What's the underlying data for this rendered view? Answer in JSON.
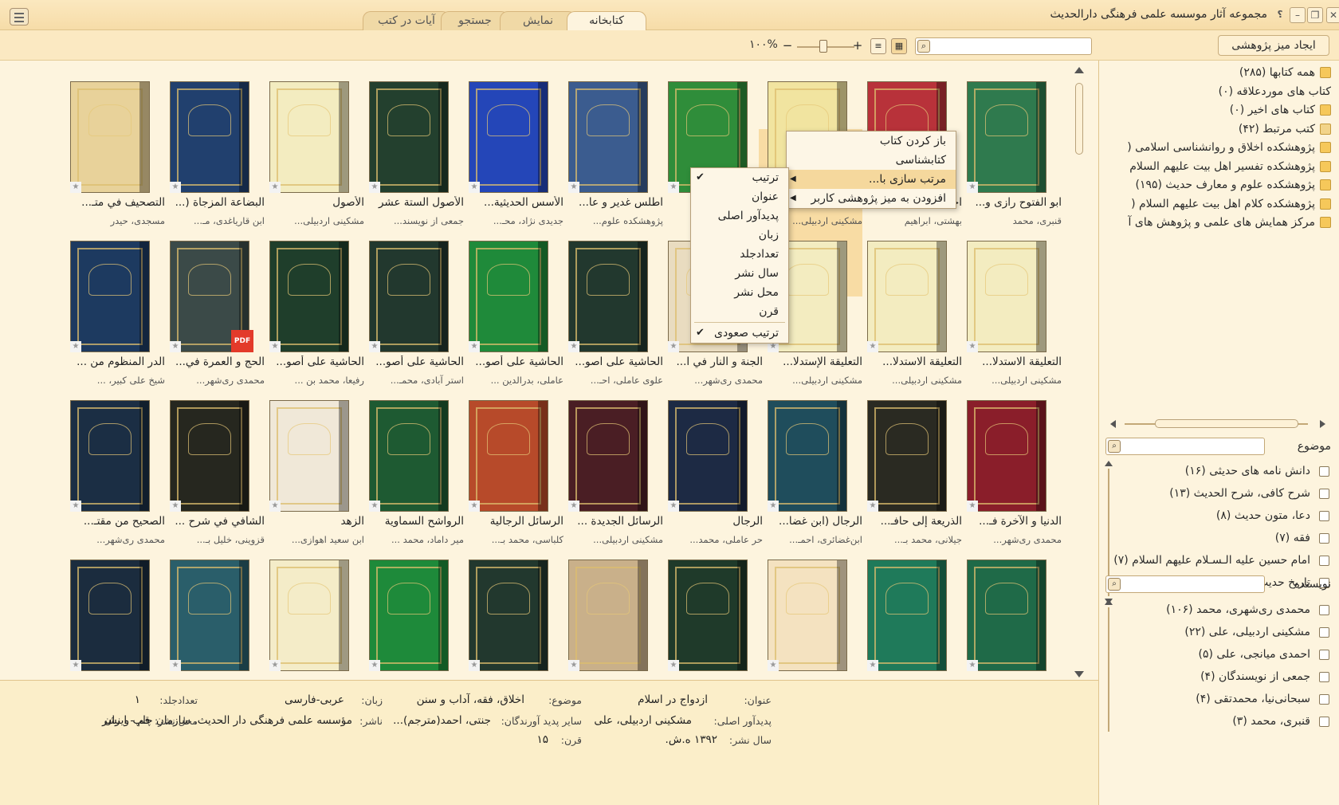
{
  "window": {
    "title": "مجموعه آثار موسسه علمی فرهنگی دارالحدیث",
    "help": "؟"
  },
  "tabs": [
    {
      "label": "کتابخانه",
      "active": true
    },
    {
      "label": "نمایش"
    },
    {
      "label": "جستجو"
    },
    {
      "label": "آیات در کتب"
    }
  ],
  "toolbar": {
    "create_desk": "ایجاد میز پژوهشی",
    "zoom_label": "۱۰۰%",
    "zoom_minus": "−",
    "zoom_plus": "+",
    "search_placeholder": ""
  },
  "books": [
    {
      "title": "ابو الفتوح رازی و...",
      "author": "قنبری، محمد",
      "color": "#2f7a4e"
    },
    {
      "title": "احمد بکیر...",
      "author": "بهشتی، ابراهیم",
      "color": "#b8323a"
    },
    {
      "title": "ازدواج در اسلام",
      "author": "مشکینی اردبیلی...",
      "color": "#f1e4a0"
    },
    {
      "title": "...ف الـ...",
      "author": "...ود",
      "color": "#2f8d3a"
    },
    {
      "title": "اطلس غدیر و عا...",
      "author": "پژوهشکده علوم...",
      "color": "#3b5c8f"
    },
    {
      "title": "الأسس الحديثية...",
      "author": "جدیدی نژاد، محـ...",
      "color": "#2446b8"
    },
    {
      "title": "الأصول الستة عشر",
      "author": "جمعی از نویسند...",
      "color": "#23402e"
    },
    {
      "title": "الأصول",
      "author": "مشکینی اردبیلی...",
      "color": "#f3ecc0"
    },
    {
      "title": "البضاعة المزجاة (...",
      "author": "ابن قاریاغدی، مـ...",
      "color": "#21406e"
    },
    {
      "title": "التصحيف في متـ...",
      "author": "مسجدی، حیدر",
      "color": "#e8d29a"
    },
    {
      "title": "التعليقة الاستدلا...",
      "author": "مشکینی اردبیلی...",
      "color": "#f3ecc0"
    },
    {
      "title": "التعليقة الاستدلا...",
      "author": "مشکینی اردبیلی...",
      "color": "#f3ecc0"
    },
    {
      "title": "التعليقة الإستدلا...",
      "author": "مشکینی اردبیلی...",
      "color": "#f3ecc0"
    },
    {
      "title": "الجنة و النار في ا...",
      "author": "محمدی ری‌شهر...",
      "color": "#e9dcc0"
    },
    {
      "title": "الحاشية على اصو...",
      "author": "علوی عاملی، احـ...",
      "color": "#22382e"
    },
    {
      "title": "الحاشية على أصو...",
      "author": "عاملی، بدرالدین ...",
      "color": "#1f8a3a"
    },
    {
      "title": "الحاشية على أصو...",
      "author": "استر آبادی، محمـ...",
      "color": "#22382e"
    },
    {
      "title": "الحاشية على أصو...",
      "author": "رفیعا، محمد بن ...",
      "color": "#1f3e2b"
    },
    {
      "title": "الحج و العمرة في...",
      "author": "محمدی ری‌شهر...",
      "color": "#3b4a48"
    },
    {
      "title": "الدر المنظوم من ...",
      "author": "شیخ علی کبیر، ...",
      "color": "#1d3a60"
    },
    {
      "title": "الدنيا و الآخرة فـ...",
      "author": "محمدی ری‌شهر...",
      "color": "#8a1e2a"
    },
    {
      "title": "الذريعة إلى حافـ...",
      "author": "جیلانی، محمد بـ...",
      "color": "#2a2a22"
    },
    {
      "title": "الرجال (ابن غضا...",
      "author": "ابن‌غضائری، احمـ...",
      "color": "#1f4d5c"
    },
    {
      "title": "الرجال",
      "author": "حر عاملی، محمد...",
      "color": "#1d2a44"
    },
    {
      "title": "الرسائل الجديدة ...",
      "author": "مشکینی اردبیلی...",
      "color": "#4a1e24"
    },
    {
      "title": "الرسائل الرجالية",
      "author": "کلباسی، محمد بـ...",
      "color": "#b74a2a"
    },
    {
      "title": "الرواشح السماوية",
      "author": "میر داماد، محمد ...",
      "color": "#1e5a32"
    },
    {
      "title": "الزهد",
      "author": "ابن سعید اهوازی...",
      "color": "#f0e8d8"
    },
    {
      "title": "الشافي في شرح ...",
      "author": "قزوینی، خلیل بـ...",
      "color": "#26271f"
    },
    {
      "title": "الصحيح من مقتـ...",
      "author": "محمدی ری‌شهر...",
      "color": "#1b2e44"
    },
    {
      "title": "",
      "author": "",
      "color": "#1f6a48"
    },
    {
      "title": "",
      "author": "",
      "color": "#1f7a5a"
    },
    {
      "title": "",
      "author": "",
      "color": "#f4e2c0"
    },
    {
      "title": "",
      "author": "",
      "color": "#1f3a2a"
    },
    {
      "title": "",
      "author": "",
      "color": "#c9b08a"
    },
    {
      "title": "",
      "author": "",
      "color": "#22382e"
    },
    {
      "title": "",
      "author": "",
      "color": "#1e8a3a"
    },
    {
      "title": "",
      "author": "",
      "color": "#f4ecc8"
    },
    {
      "title": "",
      "author": "",
      "color": "#2a5e6a"
    },
    {
      "title": "",
      "author": "",
      "color": "#1b2c3e"
    }
  ],
  "context_menu": {
    "items": [
      {
        "label": "باز کردن کتاب"
      },
      {
        "label": "کتابشناسی"
      },
      {
        "label": "مرتب سازی با...",
        "has_sub": true,
        "highlight": true
      },
      {
        "label": "افزودن به میز پژوهشی کاربر",
        "has_sub": true
      }
    ]
  },
  "sort_menu": {
    "items": [
      {
        "label": "ترتیب",
        "checked": true
      },
      {
        "label": "عنوان"
      },
      {
        "label": "پدیدآور اصلی"
      },
      {
        "label": "زبان"
      },
      {
        "label": "تعدادجلد"
      },
      {
        "label": "سال نشر"
      },
      {
        "label": "محل نشر"
      },
      {
        "label": "قرن"
      },
      {
        "label": "ترتیب صعودی",
        "checked": true
      }
    ]
  },
  "details": {
    "title_label": "عنوان:",
    "title": "ازدواج در اسلام",
    "subject_label": "موضوع:",
    "subject": "اخلاق، فقه، آداب و سنن",
    "language_label": "زبان:",
    "language": "عربی-فارسی",
    "volumes_label": "تعدادجلد:",
    "volumes": "۱",
    "author_label": "پدیدآور اصلی:",
    "author": "مشکینی اردبیلی، علی",
    "others_label": "سایر پدید آورندگان:",
    "others": "جنتی، احمد(مترجم)...",
    "publisher_label": "ناشر:",
    "publisher": "مؤسسه علمی فرهنگی دار الحدیث. سازمان چاپ و نشر",
    "place_label": "محل نشر:",
    "place": "قم - ایران",
    "year_label": "سال نشر:",
    "year": "۱۳۹۲ ه.ش.",
    "century_label": "قرن:",
    "century": "۱۵"
  },
  "tree": [
    {
      "label": "همه کتابها (۲۸۵)",
      "icon": "books-icon"
    },
    {
      "label": "کتاب های موردعلاقه (۰)",
      "icon": "star-icon"
    },
    {
      "label": "کتاب های اخیر (۰)",
      "icon": "recent-icon"
    },
    {
      "label": "کتب مرتبط (۴۲)",
      "icon": "link-icon"
    },
    {
      "label": "پژوهشکده اخلاق و روانشناسی اسلامی (",
      "icon": "folder-icon"
    },
    {
      "label": "پژوهشکده تفسیر اهل بیت علیهم السلام",
      "icon": "folder-icon"
    },
    {
      "label": "پژوهشکده علوم و معارف حدیث (۱۹۵)",
      "icon": "folder-icon"
    },
    {
      "label": "پژوهشکده کلام اهل بیت علیهم السلام (",
      "icon": "folder-icon"
    },
    {
      "label": "مرکز همایش های علمی و پژوهش های آ",
      "icon": "folder-icon"
    }
  ],
  "subject_filter": {
    "label": "موضوع",
    "items": [
      "دانش نامه های حدیثی (۱۶)",
      "شرح کافی، شرح الحدیث (۱۳)",
      "دعا، متون حدیث (۸)",
      "فقه (۷)",
      "امام حسین علیه الـسـلام علیهم السلام (۷)",
      "تاریخ حدیث (۷)"
    ]
  },
  "author_filter": {
    "label": "نویسنده",
    "items": [
      "محمدی ری‌شهری، محمد (۱۰۶)",
      "مشکینی اردبیلی، علی (۲۲)",
      "احمدی میانجی، علی (۵)",
      "جمعی از نویسندگان (۴)",
      "سبحانی‌نیا، محمدتقی (۴)",
      "قنبری، محمد (۳)"
    ]
  }
}
